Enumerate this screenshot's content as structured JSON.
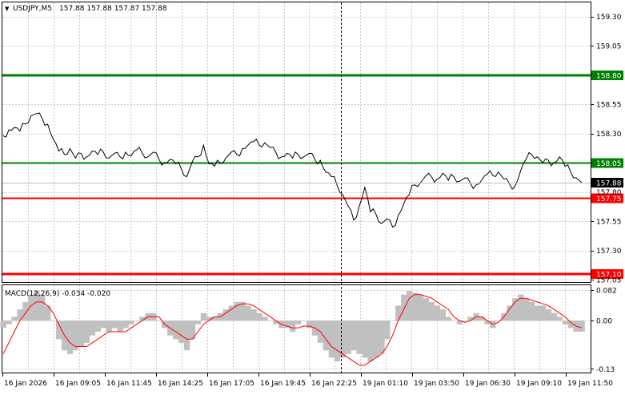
{
  "header": {
    "symbol": "USDJPY,M5",
    "ohlc": "157.88 157.88 157.87 157.88",
    "dropdown_glyph": "▼"
  },
  "colors": {
    "grid": "#c8c8c8",
    "price_line": "#000000",
    "support": "#ff0000",
    "resistance": "#008000",
    "macd_hist": "#c0c0c0",
    "macd_signal": "#ff0000",
    "current_price_bg": "#000000",
    "crosshair": "#000000"
  },
  "price_axis": {
    "ticks": [
      "159.30",
      "159.05",
      "158.55",
      "158.30",
      "157.55",
      "157.30",
      "157.05"
    ],
    "range": [
      157.03,
      159.42
    ]
  },
  "levels": [
    {
      "value": 158.8,
      "label": "158.80",
      "type": "resistance",
      "thick": true
    },
    {
      "value": 158.05,
      "label": "158.05",
      "type": "resistance",
      "thick": false
    },
    {
      "value": 157.75,
      "label": "157.75",
      "type": "support",
      "thick": false
    },
    {
      "value": 157.1,
      "label": "157.10",
      "type": "support",
      "thick": true
    }
  ],
  "current_price": {
    "value": 157.88,
    "label": "157.88",
    "hidden_tick": "157.80"
  },
  "macd": {
    "title": "MACD(12,26,9) -0.034 -0.020",
    "ticks": [
      "0.082",
      "0.00",
      "-0.13"
    ],
    "range": [
      -0.14,
      0.095
    ]
  },
  "time_axis": {
    "labels": [
      "16 Jan 2026",
      "16 Jan 09:05",
      "16 Jan 11:45",
      "16 Jan 14:25",
      "16 Jan 17:05",
      "16 Jan 19:45",
      "16 Jan 22:25",
      "19 Jan 01:10",
      "19 Jan 03:50",
      "19 Jan 06:30",
      "19 Jan 09:10",
      "19 Jan 11:50"
    ]
  },
  "chart_data": {
    "type": "line",
    "symbol": "USDJPY",
    "timeframe": "M5",
    "ylim": [
      157.03,
      159.42
    ],
    "x_labels": [
      "16 Jan 2026",
      "16 Jan 09:05",
      "16 Jan 11:45",
      "16 Jan 14:25",
      "16 Jan 17:05",
      "16 Jan 19:45",
      "16 Jan 22:25",
      "19 Jan 01:10",
      "19 Jan 03:50",
      "19 Jan 06:30",
      "19 Jan 09:10",
      "19 Jan 11:50"
    ],
    "price_series": [
      158.28,
      158.33,
      158.35,
      158.32,
      158.38,
      158.45,
      158.47,
      158.43,
      158.38,
      158.25,
      158.15,
      158.12,
      158.17,
      158.09,
      158.13,
      158.1,
      158.15,
      158.12,
      158.14,
      158.09,
      158.13,
      158.1,
      158.14,
      158.11,
      158.16,
      158.13,
      158.1,
      158.14,
      158.08,
      158.05,
      158.08,
      158.04,
      158.0,
      157.93,
      158.06,
      158.1,
      158.2,
      158.04,
      158.02,
      158.05,
      158.09,
      158.14,
      158.12,
      158.17,
      158.2,
      158.23,
      158.2,
      158.22,
      158.18,
      158.14,
      158.1,
      158.13,
      158.09,
      158.12,
      158.1,
      158.13,
      158.08,
      158.07,
      157.97,
      157.93,
      157.86,
      157.78,
      157.68,
      157.56,
      157.68,
      157.84,
      157.63,
      157.61,
      157.53,
      157.57,
      157.5,
      157.6,
      157.7,
      157.78,
      157.86,
      157.88,
      157.94,
      157.93,
      157.91,
      157.96,
      157.9,
      157.93,
      157.89,
      157.92,
      157.87,
      157.86,
      157.9,
      157.95,
      157.94,
      157.97,
      157.91,
      157.87,
      157.85,
      157.98,
      158.08,
      158.12,
      158.1,
      158.05,
      158.07,
      158.05,
      158.1,
      158.02,
      157.97,
      157.92,
      157.88
    ],
    "levels": [
      158.8,
      158.05,
      157.75,
      157.1
    ],
    "macd_histogram": [
      -0.02,
      -0.01,
      0.01,
      0.03,
      0.05,
      0.07,
      0.08,
      0.07,
      0.04,
      0.0,
      -0.05,
      -0.08,
      -0.09,
      -0.08,
      -0.07,
      -0.06,
      -0.04,
      -0.03,
      -0.02,
      -0.03,
      -0.02,
      -0.03,
      -0.02,
      -0.01,
      0.0,
      0.01,
      0.02,
      0.02,
      0.0,
      -0.02,
      -0.04,
      -0.05,
      -0.06,
      -0.08,
      -0.05,
      -0.01,
      0.02,
      0.01,
      0.01,
      0.02,
      0.03,
      0.04,
      0.05,
      0.05,
      0.04,
      0.03,
      0.02,
      0.01,
      0.0,
      -0.01,
      -0.02,
      -0.02,
      -0.03,
      -0.01,
      0.0,
      -0.02,
      -0.04,
      -0.06,
      -0.08,
      -0.1,
      -0.11,
      -0.1,
      -0.09,
      -0.08,
      -0.09,
      -0.1,
      -0.11,
      -0.1,
      -0.09,
      -0.05,
      0.0,
      0.04,
      0.07,
      0.08,
      0.075,
      0.07,
      0.06,
      0.05,
      0.04,
      0.03,
      0.01,
      0.0,
      -0.01,
      0.0,
      0.01,
      0.02,
      0.01,
      -0.01,
      -0.02,
      0.0,
      0.02,
      0.04,
      0.06,
      0.07,
      0.06,
      0.05,
      0.04,
      0.04,
      0.03,
      0.02,
      0.01,
      -0.01,
      -0.02,
      -0.03,
      -0.03
    ],
    "macd_signal": [
      -0.09,
      -0.06,
      -0.03,
      0.0,
      0.02,
      0.04,
      0.05,
      0.05,
      0.04,
      0.02,
      -0.01,
      -0.04,
      -0.06,
      -0.07,
      -0.07,
      -0.07,
      -0.06,
      -0.05,
      -0.04,
      -0.03,
      -0.03,
      -0.03,
      -0.03,
      -0.02,
      -0.01,
      0.0,
      0.01,
      0.01,
      0.01,
      -0.01,
      -0.02,
      -0.03,
      -0.04,
      -0.05,
      -0.05,
      -0.03,
      -0.01,
      0.0,
      0.01,
      0.01,
      0.02,
      0.03,
      0.04,
      0.045,
      0.045,
      0.04,
      0.03,
      0.02,
      0.01,
      0.0,
      -0.01,
      -0.015,
      -0.02,
      -0.02,
      -0.015,
      -0.015,
      -0.02,
      -0.03,
      -0.05,
      -0.07,
      -0.08,
      -0.09,
      -0.1,
      -0.11,
      -0.12,
      -0.12,
      -0.11,
      -0.1,
      -0.09,
      -0.07,
      -0.04,
      0.0,
      0.03,
      0.06,
      0.07,
      0.07,
      0.065,
      0.06,
      0.05,
      0.04,
      0.03,
      0.01,
      0.0,
      -0.005,
      0.0,
      0.01,
      0.01,
      0.0,
      -0.01,
      -0.005,
      0.01,
      0.03,
      0.05,
      0.06,
      0.06,
      0.055,
      0.05,
      0.045,
      0.04,
      0.03,
      0.02,
      0.01,
      -0.005,
      -0.015,
      -0.02
    ]
  }
}
